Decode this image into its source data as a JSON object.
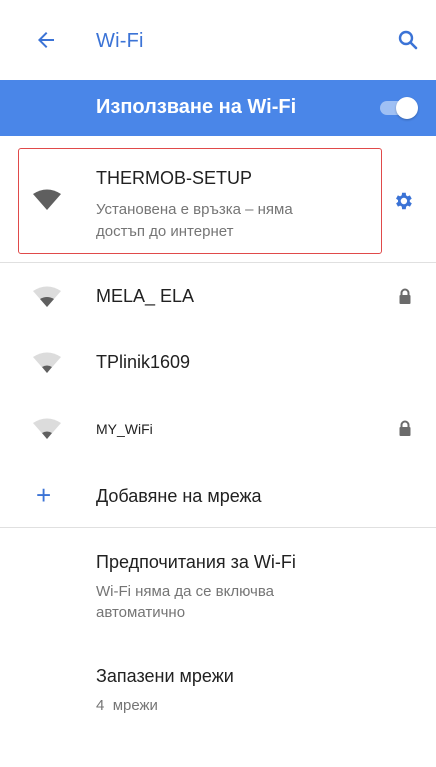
{
  "appbar": {
    "title": "Wi-Fi"
  },
  "use_wifi": {
    "label": "Използване на Wi-Fi",
    "enabled": true
  },
  "networks": [
    {
      "ssid": "THERMOB-SETUP",
      "status": "Установена е връзка – няма достъп до интернет",
      "status_line1": "Установена е връзка – няма",
      "status_line2": "достъп до интернет",
      "secured": false,
      "connected": true
    },
    {
      "ssid": "MELA_ ELA",
      "secured": true
    },
    {
      "ssid": "TPlinik1609",
      "secured": false
    },
    {
      "ssid": "MY_WiFi",
      "secured": true
    }
  ],
  "add_network": {
    "label": "Добавяне на мрежа"
  },
  "preferences": {
    "title": "Предпочитания за Wi-Fi",
    "subtitle_line1": "Wi-Fi няма да се включва",
    "subtitle_line2": "автоматично"
  },
  "saved_networks": {
    "title": "Запазени мрежи",
    "count": "4",
    "unit": "мрежи"
  },
  "colors": {
    "accent": "#3b73d6",
    "bar": "#4a86e8",
    "highlight_border": "#e04a4a"
  }
}
